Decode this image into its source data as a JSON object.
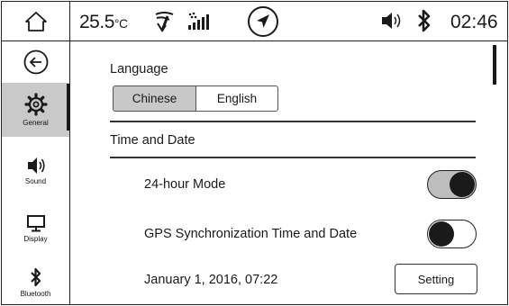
{
  "status_bar": {
    "temperature": "25.5",
    "temperature_unit": "°C",
    "time": "02:46",
    "icons": [
      "home-icon",
      "wind-icon",
      "signal-icon",
      "navigation-icon",
      "volume-icon",
      "bluetooth-icon"
    ]
  },
  "sidebar": {
    "items": [
      {
        "label": "",
        "icon": "back-icon"
      },
      {
        "label": "General",
        "icon": "gear-icon",
        "active": true
      },
      {
        "label": "Sound",
        "icon": "speaker-icon"
      },
      {
        "label": "Display",
        "icon": "monitor-icon"
      },
      {
        "label": "Bluetooth",
        "icon": "bluetooth-icon"
      }
    ]
  },
  "content": {
    "language": {
      "title": "Language",
      "options": [
        "Chinese",
        "English"
      ],
      "selected": "Chinese"
    },
    "time_and_date": {
      "title": "Time and Date",
      "hour_mode_label": "24-hour Mode",
      "hour_mode_on": true,
      "gps_sync_label": "GPS Synchronization Time and Date",
      "gps_sync_on": false,
      "current_datetime": "January 1, 2016, 07:22",
      "setting_label": "Setting"
    }
  }
}
